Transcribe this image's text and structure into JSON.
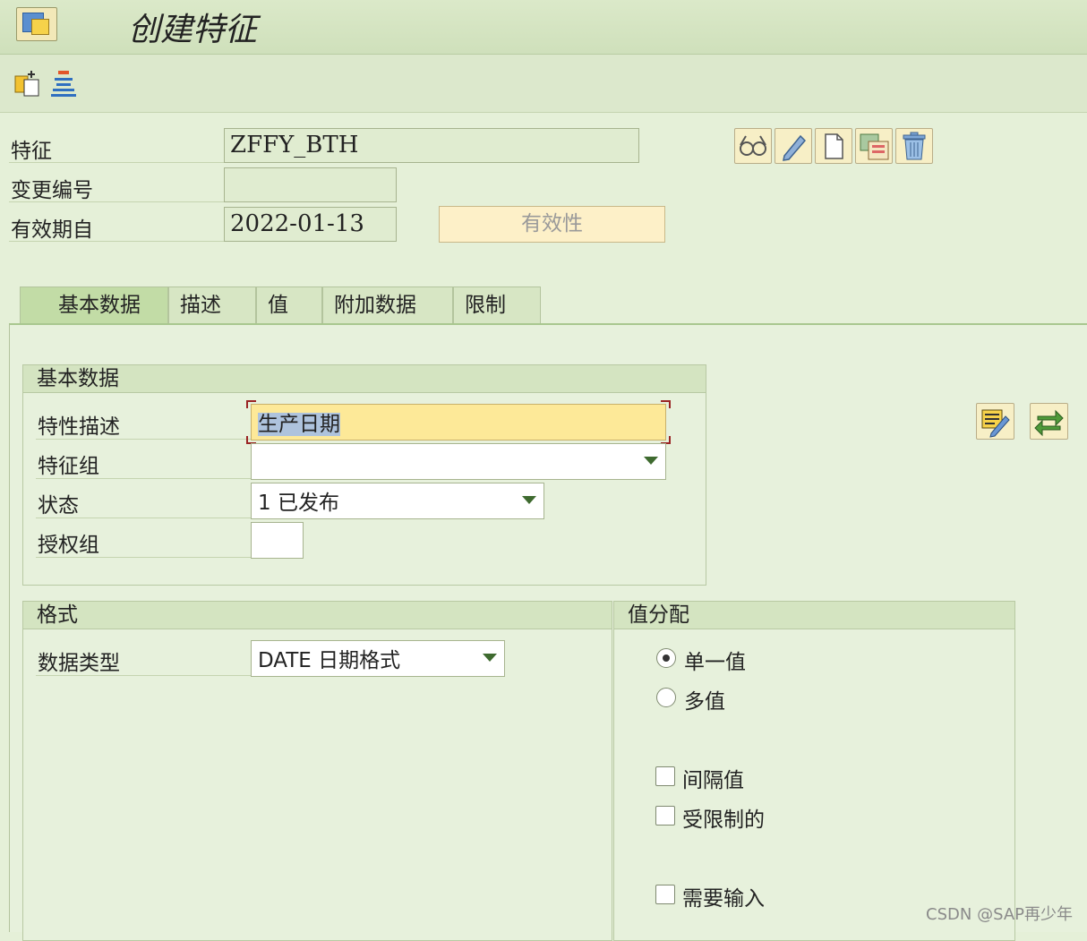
{
  "window": {
    "title": "创建特征"
  },
  "header_fields": {
    "characteristic": {
      "label": "特征",
      "value": "ZFFY_BTH"
    },
    "change_number": {
      "label": "变更编号",
      "value": ""
    },
    "valid_from": {
      "label": "有效期自",
      "value": "2022-01-13"
    },
    "validity_button": "有效性"
  },
  "tabs": [
    {
      "label": "基本数据",
      "active": true
    },
    {
      "label": "描述",
      "active": false
    },
    {
      "label": "值",
      "active": false
    },
    {
      "label": "附加数据",
      "active": false
    },
    {
      "label": "限制",
      "active": false
    }
  ],
  "basic_data": {
    "title": "基本数据",
    "description": {
      "label": "特性描述",
      "value": "生产日期"
    },
    "char_group": {
      "label": "特征组",
      "value": ""
    },
    "status": {
      "label": "状态",
      "value": "1 已发布"
    },
    "auth_group": {
      "label": "授权组",
      "value": ""
    }
  },
  "format": {
    "title": "格式",
    "data_type": {
      "label": "数据类型",
      "value": "DATE 日期格式"
    }
  },
  "value_assignment": {
    "title": "值分配",
    "single_value": {
      "label": "单一值",
      "checked": true
    },
    "multiple_values": {
      "label": "多值",
      "checked": false
    },
    "interval_values": {
      "label": "间隔值",
      "checked": false
    },
    "restricted": {
      "label": "受限制的",
      "checked": false
    },
    "entry_required": {
      "label": "需要输入",
      "checked": false
    }
  },
  "icons": [
    "display-icon",
    "change-icon",
    "create-icon",
    "copy-icon",
    "delete-icon",
    "text-edit-icon",
    "swap-icon"
  ],
  "watermark": "CSDN @SAP再少年",
  "colors": {
    "background": "#e5f0d8",
    "accent": "#c2dca6",
    "focus": "#fde998"
  }
}
